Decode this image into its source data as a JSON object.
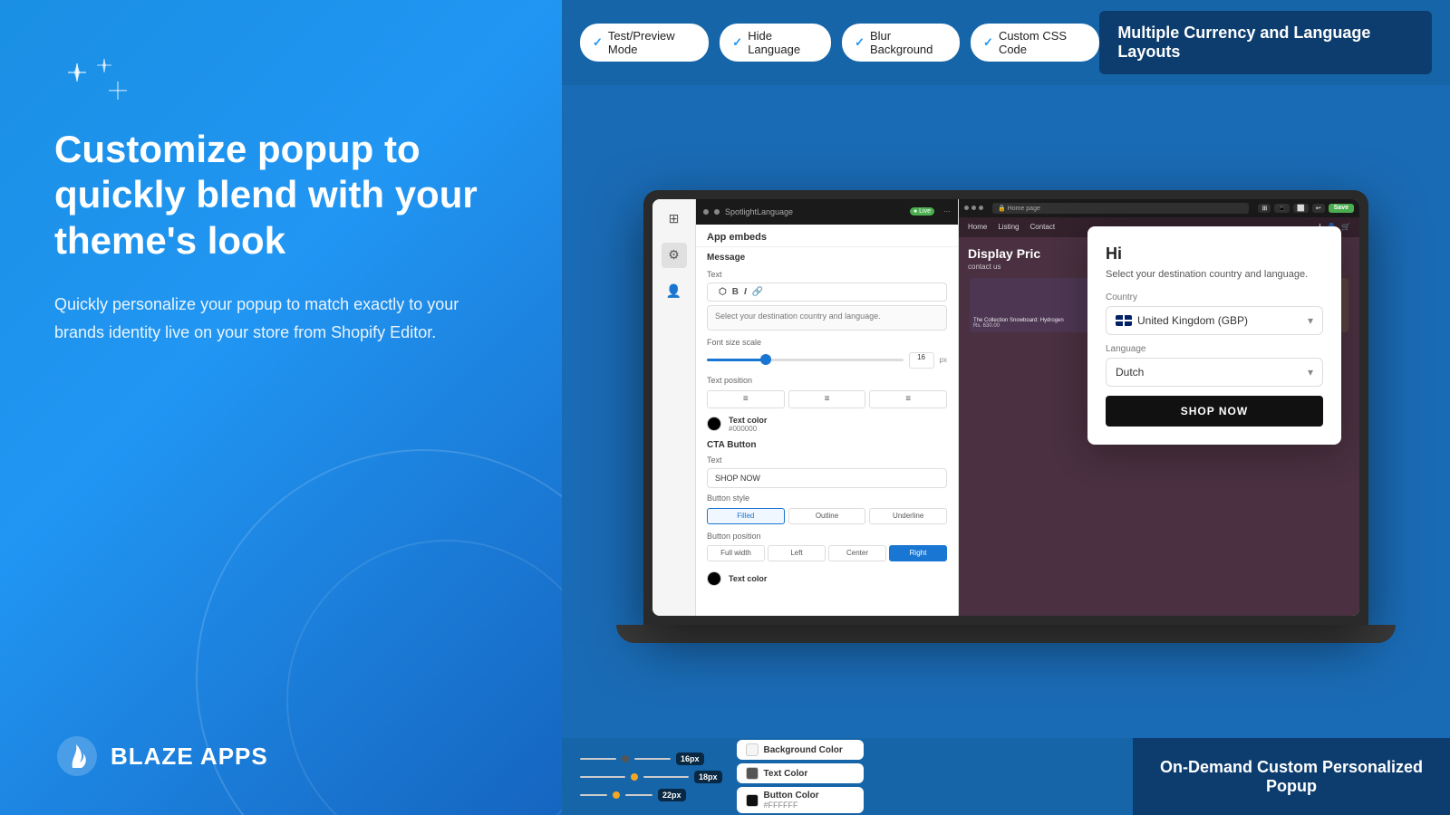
{
  "left": {
    "sparkles": "✦ ✦\n  ✦",
    "heading": "Customize popup to quickly blend with your theme's look",
    "subtext": "Quickly personalize your popup to match exactly to your brands identity live on your store from Shopify Editor.",
    "logo_text": "BLAZE APPS"
  },
  "top_bar": {
    "badges": [
      {
        "id": "test-preview",
        "label": "Test/Preview Mode"
      },
      {
        "id": "hide-language",
        "label": "Hide Language"
      },
      {
        "id": "blur-background",
        "label": "Blur Background"
      },
      {
        "id": "custom-css",
        "label": "Custom CSS Code"
      }
    ],
    "right_label": "Multiple Currency and Language Layouts"
  },
  "editor": {
    "app_embeds_label": "App embeds",
    "message_label": "Message",
    "text_label": "Text",
    "toolbar_buttons": [
      "⬡",
      "B",
      "I",
      "🔗"
    ],
    "text_placeholder": "Select your destination country and language.",
    "font_size_label": "Font size scale",
    "font_size_value": "16",
    "font_size_unit": "px",
    "text_position_label": "Text position",
    "text_color_label": "Text color",
    "text_color_value": "#000000",
    "cta_button_label": "CTA Button",
    "cta_text_label": "Text",
    "cta_text_value": "SHOP NOW",
    "button_style_label": "Button style",
    "button_styles": [
      "Filled",
      "Outline",
      "Underline"
    ],
    "button_position_label": "Button position",
    "button_positions": [
      "Full width",
      "Left",
      "Center",
      "Right"
    ],
    "text_color_section": "Text color"
  },
  "popup": {
    "hi_text": "Hi",
    "description": "Select your destination country and language.",
    "country_label": "Country",
    "country_value": "United Kingdom (GBP)",
    "language_label": "Language",
    "language_value": "Dutch",
    "shop_now_label": "SHOP NOW"
  },
  "store": {
    "nav_items": [
      "Home",
      "Listing",
      "Contact"
    ],
    "banner_text": "Display Pric",
    "banner_sub": "contact us"
  },
  "bottom": {
    "font_sizes": [
      "16px",
      "18px",
      "22px"
    ],
    "color_controls": [
      {
        "id": "background-color",
        "label": "Background Color",
        "color": "#ffffff"
      },
      {
        "id": "text-color",
        "label": "Text Color",
        "color": "#333333"
      },
      {
        "id": "button-color",
        "label": "Button Color",
        "value": "#FFFFFF",
        "color": "#111111"
      }
    ],
    "right_label": "On-Demand Custom Personalized Popup"
  }
}
